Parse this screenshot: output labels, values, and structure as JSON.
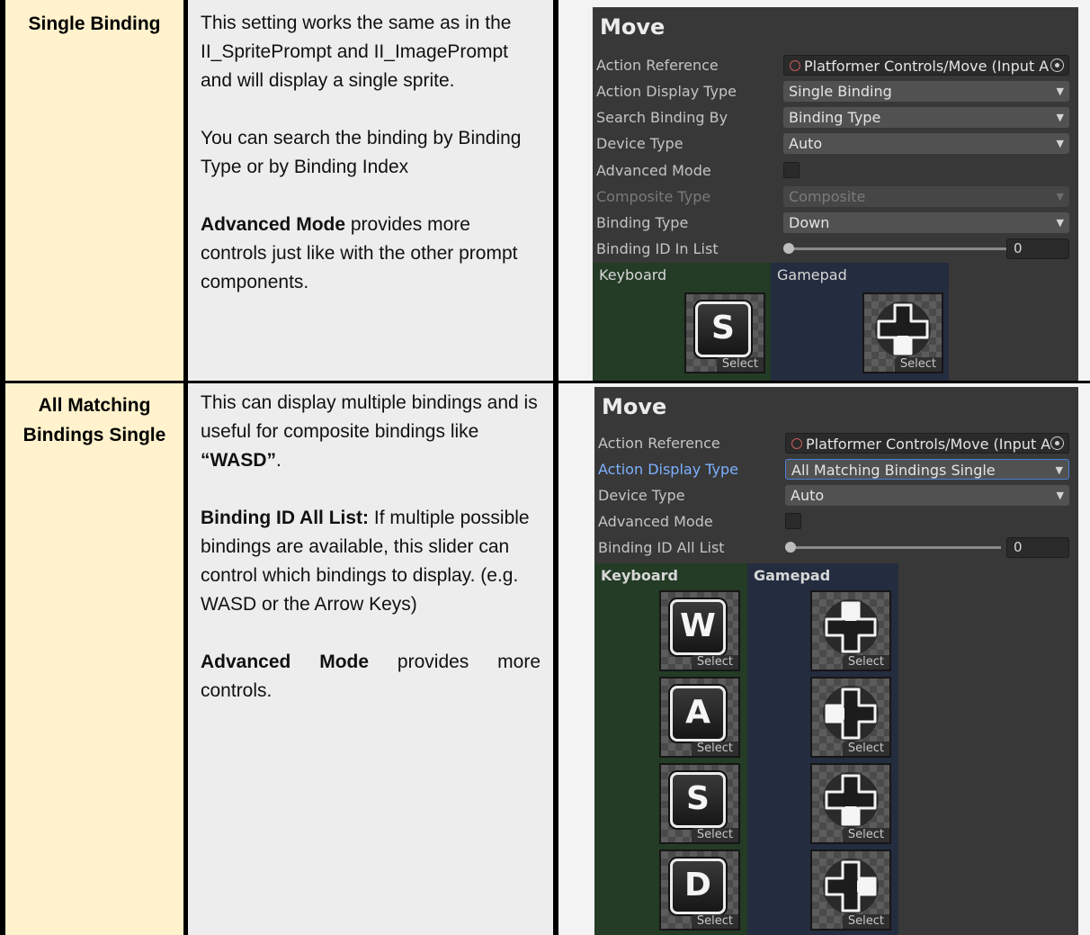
{
  "rows": [
    {
      "label_lines": [
        "Single Binding"
      ],
      "paragraphs": [
        {
          "text": "This setting works the same as in the II_SpritePrompt and II_ImagePrompt and will display a single sprite."
        },
        {
          "text": "You can search the binding by Binding Type or by Binding Index"
        },
        {
          "bold": "Advanced Mode",
          "text": " provides more controls just like with the other prompt components."
        }
      ],
      "inspector": {
        "title": "Move",
        "fields": [
          {
            "label": "Action Reference",
            "value": "Platformer Controls/Move (Input A",
            "kind": "objref",
            "icon": "input-action-icon"
          },
          {
            "label": "Action Display Type",
            "value": "Single Binding",
            "kind": "dropdown"
          },
          {
            "label": "Search Binding By",
            "value": "Binding Type",
            "kind": "dropdown"
          },
          {
            "label": "Device Type",
            "value": "Auto",
            "kind": "dropdown"
          },
          {
            "label": "Advanced Mode",
            "kind": "checkbox",
            "checked": false
          },
          {
            "label": "Composite Type",
            "value": "Composite",
            "kind": "dropdown",
            "disabled": true
          },
          {
            "label": "Binding Type",
            "value": "Down",
            "kind": "dropdown"
          },
          {
            "label": "Binding ID In List",
            "value": "0",
            "kind": "slider",
            "slider_value": 0
          }
        ],
        "keyboard_label": "Keyboard",
        "gamepad_label": "Gamepad",
        "select_label": "Select",
        "keyboard_keys": [
          "S"
        ],
        "gamepad_dirs": [
          "down"
        ]
      }
    },
    {
      "label_lines": [
        "All Matching",
        "Bindings Single"
      ],
      "paragraphs": [
        {
          "text": "This can display multiple bindings and is useful for composite bindings like ",
          "bold_inline": "“WASD”",
          "after": "."
        },
        {
          "bold": "Binding ID All List:",
          "text": " If multiple possible bindings are available, this slider can control which bindings to display. (e.g. WASD or the Arrow Keys)"
        },
        {
          "bold": "Advanced Mode",
          "text": " provides more controls."
        }
      ],
      "inspector": {
        "title": "Move",
        "fields": [
          {
            "label": "Action Reference",
            "value": "Platformer Controls/Move (Input A",
            "kind": "objref",
            "icon": "input-action-icon"
          },
          {
            "label": "Action Display Type",
            "value": "All Matching Bindings Single",
            "kind": "dropdown",
            "highlight": true
          },
          {
            "label": "Device Type",
            "value": "Auto",
            "kind": "dropdown"
          },
          {
            "label": "Advanced Mode",
            "kind": "checkbox",
            "checked": false
          },
          {
            "label": "Binding ID All List",
            "value": "0",
            "kind": "slider",
            "slider_value": 0
          }
        ],
        "keyboard_label": "Keyboard",
        "gamepad_label": "Gamepad",
        "select_label": "Select",
        "keyboard_keys": [
          "W",
          "A",
          "S",
          "D"
        ],
        "gamepad_dirs": [
          "up",
          "left",
          "down",
          "right"
        ]
      }
    }
  ],
  "colors": {
    "label_bg": "#fff2cc",
    "desc_bg": "#ededed",
    "inspector_bg": "#383838",
    "keyboard_panel": "#243b26",
    "gamepad_panel": "#242c3f",
    "highlight_label": "#7cb0ff"
  }
}
